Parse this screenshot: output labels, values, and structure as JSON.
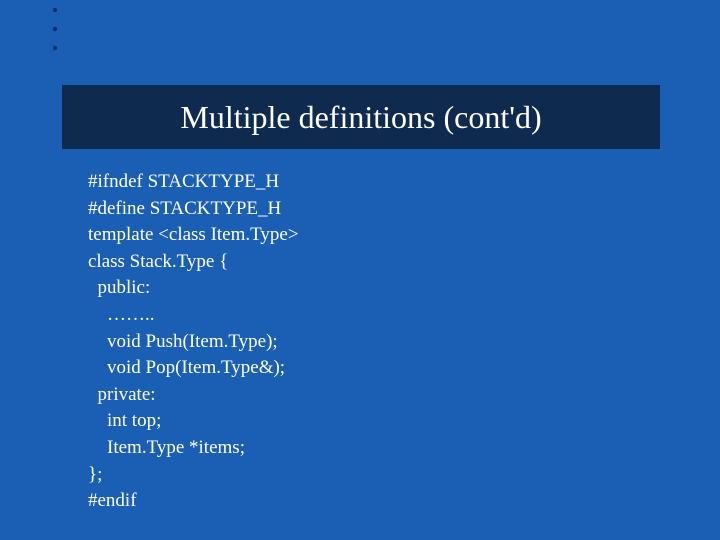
{
  "title": "Multiple definitions (cont'd)",
  "code": {
    "line1": "#ifndef STACKTYPE_H",
    "line2": "#define STACKTYPE_H",
    "line3": "template <class Item.Type>",
    "line4": "class Stack.Type {",
    "line5": "  public:",
    "line6": "    ……..",
    "line7": "    void Push(Item.Type);",
    "line8": "    void Pop(Item.Type&);",
    "line9": "  private:",
    "line10": "    int top;",
    "line11": "    Item.Type *items;",
    "line12": "};",
    "line13": "#endif"
  }
}
